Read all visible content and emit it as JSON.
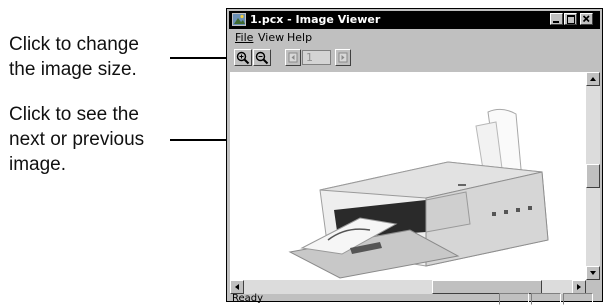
{
  "callouts": {
    "zoom_lines": [
      "Click to change",
      "the image size."
    ],
    "nav_lines": [
      "Click to see the",
      "next or previous",
      "image."
    ]
  },
  "window": {
    "title": "1.pcx - Image Viewer",
    "menu": [
      "File",
      "View",
      "Help"
    ],
    "page_number": "1",
    "status": "Ready"
  },
  "icons": [
    "image-viewer-app-icon",
    "zoom-in-icon",
    "zoom-out-icon",
    "previous-page-icon",
    "next-page-icon",
    "minimize-icon",
    "maximize-icon",
    "close-icon"
  ],
  "colors": {
    "title_bar": "#000000",
    "window_face": "#c0c0c0",
    "scroll_track": "#dcdcdc"
  }
}
